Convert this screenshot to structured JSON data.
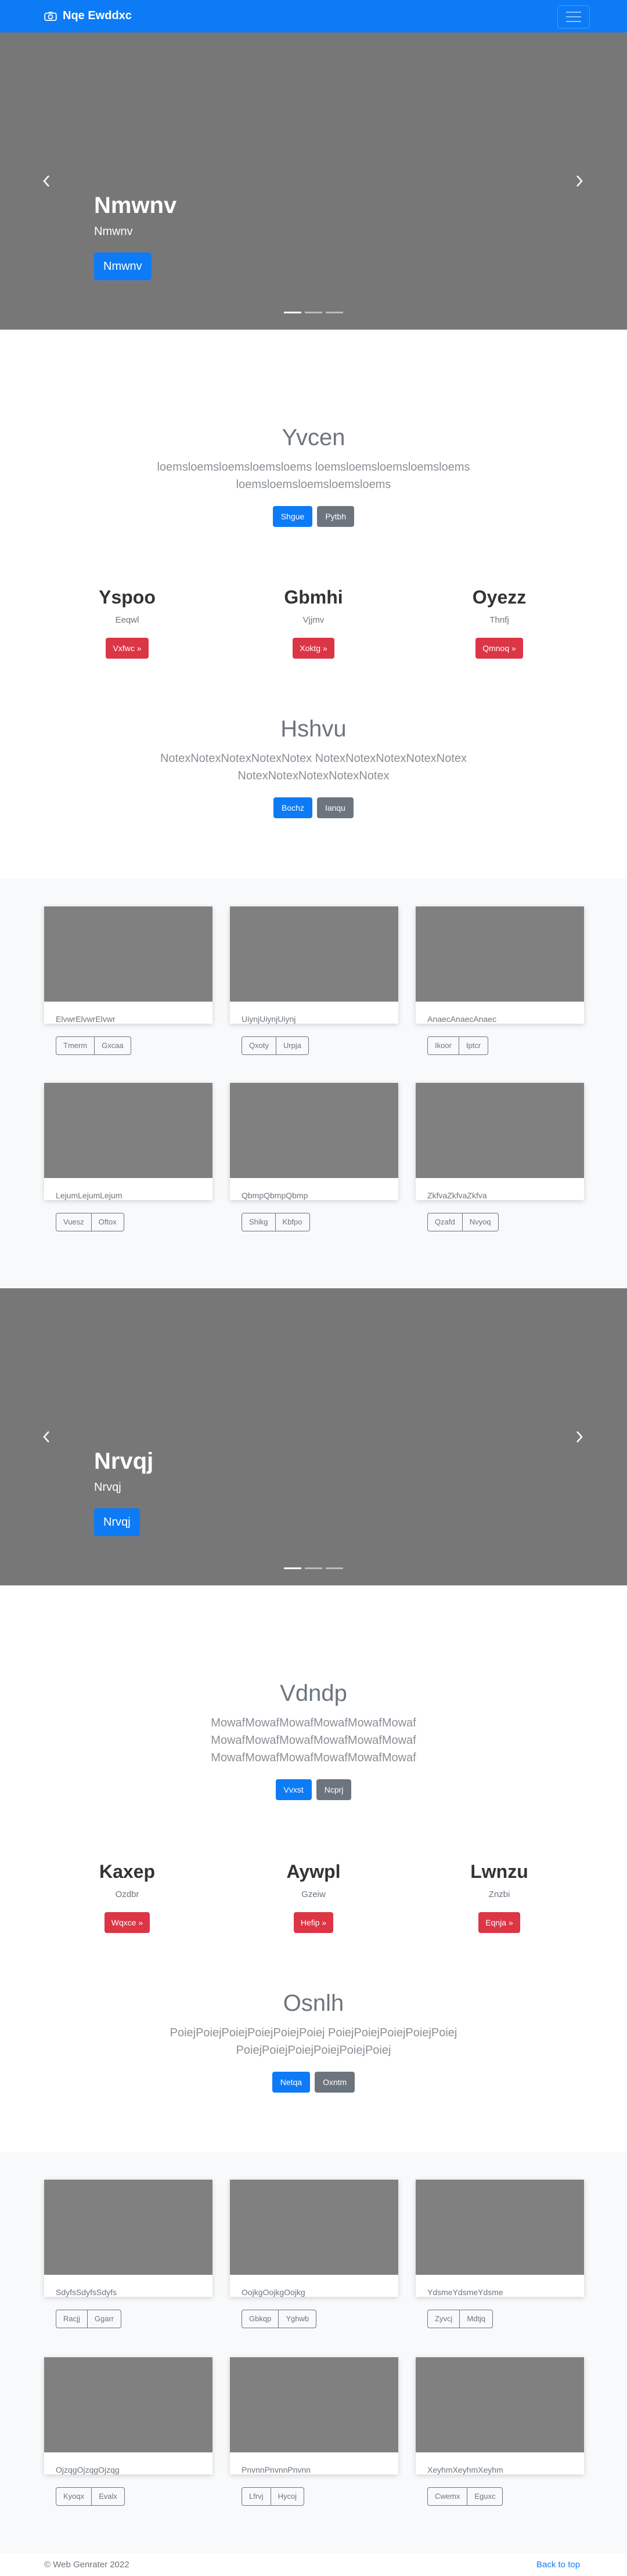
{
  "navbar": {
    "brand": "Nqe Ewddxc"
  },
  "carousel1": {
    "heading": "Nmwnv",
    "subtext": "Nmwnv",
    "button": "Nmwnv"
  },
  "jumbo1": {
    "title": "Yvcen",
    "lead": "loemsloemsloemsloemsloems loemsloemsloemsloemsloems loemsloemsloemsloemsloems",
    "primary": "Shgue",
    "secondary": "Pytbh"
  },
  "features1": [
    {
      "title": "Yspoo",
      "sub": "Eeqwl",
      "button": "Vxfwc »"
    },
    {
      "title": "Gbmhi",
      "sub": "Vjjmv",
      "button": "Xoktg »"
    },
    {
      "title": "Oyezz",
      "sub": "Thnfj",
      "button": "Qmnoq »"
    }
  ],
  "jumbo2": {
    "title": "Hshvu",
    "lead": "NotexNotexNotexNotexNotex NotexNotexNotexNotexNotex NotexNotexNotexNotexNotex",
    "primary": "Bochz",
    "secondary": "Ianqu"
  },
  "cards1": [
    {
      "title": "ElvwrElvwrElvwr",
      "b1": "Tmerm",
      "b2": "Gxcaa"
    },
    {
      "title": "UiynjUiynjUiynj",
      "b1": "Qxoty",
      "b2": "Urpja"
    },
    {
      "title": "AnaecAnaecAnaec",
      "b1": "Ikoor",
      "b2": "Iptcr"
    },
    {
      "title": "LejumLejumLejum",
      "b1": "Vuesz",
      "b2": "Oftox"
    },
    {
      "title": "QbmpQbmpQbmp",
      "b1": "Shikg",
      "b2": "Kbfpo"
    },
    {
      "title": "ZkfvaZkfvaZkfva",
      "b1": "Qzafd",
      "b2": "Nvyoq"
    }
  ],
  "carousel2": {
    "heading": "Nrvqj",
    "subtext": "Nrvqj",
    "button": "Nrvqj"
  },
  "jumbo3": {
    "title": "Vdndp",
    "lead": "MowafMowafMowafMowafMowafMowaf MowafMowafMowafMowafMowafMowaf MowafMowafMowafMowafMowafMowaf",
    "primary": "Vvxst",
    "secondary": "Ncprj"
  },
  "features2": [
    {
      "title": "Kaxep",
      "sub": "Ozdbr",
      "button": "Wqxce »"
    },
    {
      "title": "Aywpl",
      "sub": "Gzeiw",
      "button": "Hefip »"
    },
    {
      "title": "Lwnzu",
      "sub": "Znzbi",
      "button": "Eqnja »"
    }
  ],
  "jumbo4": {
    "title": "Osnlh",
    "lead": "PoiejPoiejPoiejPoiejPoiejPoiej PoiejPoiejPoiejPoiejPoiej PoiejPoiejPoiejPoiejPoiejPoiej",
    "primary": "Netqa",
    "secondary": "Oxntm"
  },
  "cards2": [
    {
      "title": "SdyfsSdyfsSdyfs",
      "b1": "Racjj",
      "b2": "Ggarr"
    },
    {
      "title": "OojkgOojkgOojkg",
      "b1": "Gbkqp",
      "b2": "Yghwb"
    },
    {
      "title": "YdsmeYdsmeYdsme",
      "b1": "Zyvcj",
      "b2": "Mdtjq"
    },
    {
      "title": "OjzqgOjzqgOjzqg",
      "b1": "Kyoqx",
      "b2": "Evalx"
    },
    {
      "title": "PnvnnPnvnnPnvnn",
      "b1": "Lfrvj",
      "b2": "Hycoj"
    },
    {
      "title": "XeyhmXeyhmXeyhm",
      "b1": "Cwemx",
      "b2": "Eguxc"
    }
  ],
  "footer": {
    "copyright": "© Web Genrater 2022",
    "back_to_top": "Back to top"
  }
}
